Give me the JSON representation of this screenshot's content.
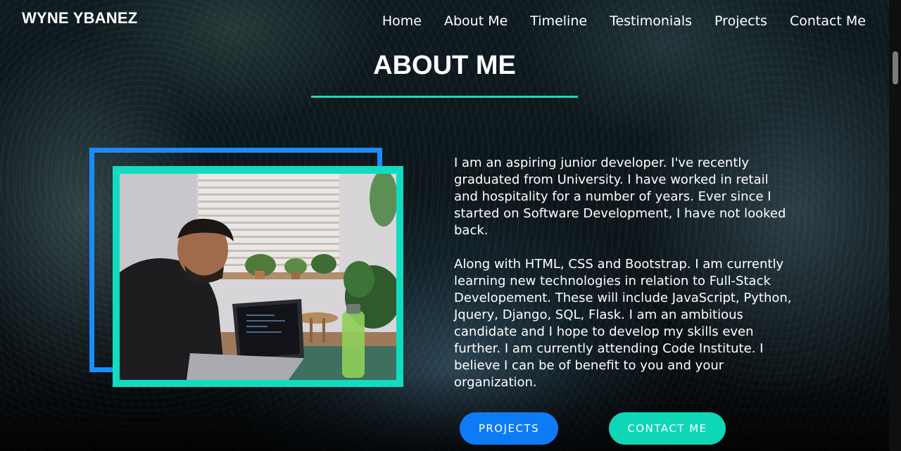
{
  "brand": {
    "name": "WYNE YBANEZ"
  },
  "nav": {
    "items": [
      "Home",
      "About Me",
      "Timeline",
      "Testimonials",
      "Projects",
      "Contact Me"
    ]
  },
  "about": {
    "title": "ABOUT ME",
    "paragraphs": [
      "I am an aspiring junior developer. I've recently graduated from University. I have worked in retail and hospitality for a number of years. Ever since I started on Software Development, I have not looked back.",
      "Along with HTML, CSS and Bootstrap. I am currently learning new technologies in relation to Full-Stack Developement. These will include JavaScript, Python, Jquery, Django, SQL, Flask. I am an ambitious candidate and I hope to develop my skills even further. I am currently attending Code Institute. I believe I can be of benefit to you and your organization."
    ]
  },
  "buttons": {
    "projects": "PROJECTS",
    "contact": "CONTACT ME"
  },
  "colors": {
    "accent_teal": "#10d6b8",
    "accent_blue": "#0d7bf5"
  }
}
